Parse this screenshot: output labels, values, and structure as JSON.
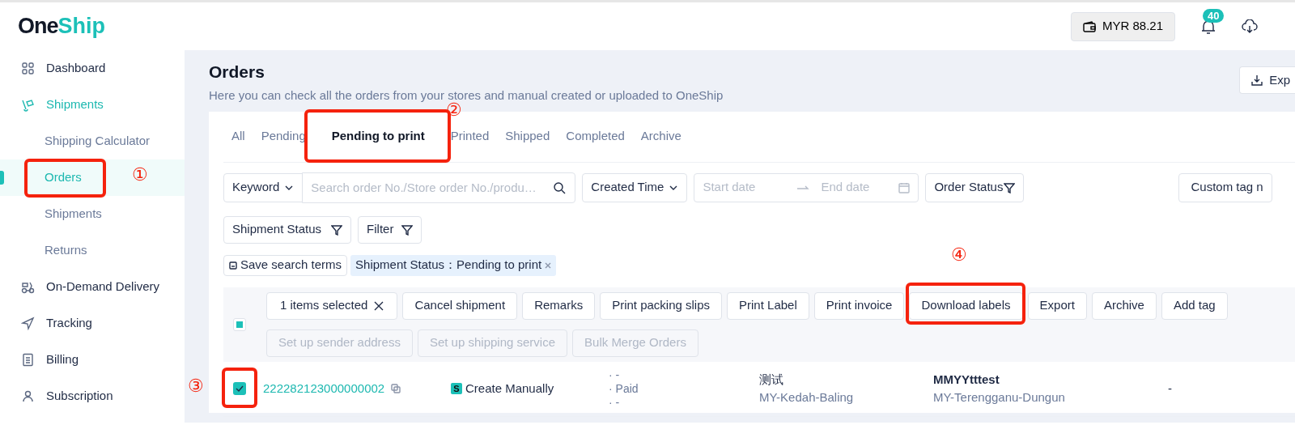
{
  "logo": {
    "part_1": "One",
    "part_2": "Ship"
  },
  "header": {
    "balance": "MYR 88.21",
    "notification_count": "40"
  },
  "sidebar": {
    "items": [
      {
        "label": "Dashboard"
      },
      {
        "label": "Shipments",
        "children": [
          {
            "label": "Shipping Calculator",
            "selected": false
          },
          {
            "label": "Orders",
            "selected": true,
            "callout": "①"
          },
          {
            "label": "Shipments",
            "selected": false
          },
          {
            "label": "Returns",
            "selected": false
          }
        ]
      },
      {
        "label": "On-Demand Delivery"
      },
      {
        "label": "Tracking"
      },
      {
        "label": "Billing"
      },
      {
        "label": "Subscription"
      }
    ]
  },
  "page": {
    "title": "Orders",
    "subtitle": "Here you can check all the orders from your stores and manual created or uploaded to OneShip",
    "export_button": "Exp"
  },
  "tabs": [
    {
      "label": "All",
      "selected": false
    },
    {
      "label": "Pending",
      "selected": false
    },
    {
      "label": "Pending to print",
      "selected": true,
      "callout": "②"
    },
    {
      "label": "Printed",
      "selected": false
    },
    {
      "label": "Shipped",
      "selected": false
    },
    {
      "label": "Completed",
      "selected": false
    },
    {
      "label": "Archive",
      "selected": false
    }
  ],
  "filters": {
    "keyword": "Keyword",
    "search_placeholder": "Search order No./Store order No./produ…",
    "created_time": "Created Time",
    "start_placeholder": "Start date",
    "end_placeholder": "End date",
    "order_status": "Order Status",
    "custom_tag": "Custom tag n",
    "shipment_status": "Shipment Status",
    "filter": "Filter"
  },
  "saved": {
    "save_button": "Save search terms",
    "chips": [
      "Shipment Status：Pending to print"
    ]
  },
  "bulk": {
    "select_all_indeterminate": true,
    "selected_count": "1 items selected",
    "actions": [
      {
        "label": "Cancel shipment",
        "disabled": false
      },
      {
        "label": "Remarks",
        "disabled": false
      },
      {
        "label": "Print packing slips",
        "disabled": false
      },
      {
        "label": "Print Label",
        "disabled": false
      },
      {
        "label": "Print invoice",
        "disabled": false
      },
      {
        "label": "Download labels",
        "disabled": false,
        "callout": "④"
      },
      {
        "label": "Export",
        "disabled": false
      },
      {
        "label": "Archive",
        "disabled": false
      },
      {
        "label": "Add tag",
        "disabled": false
      },
      {
        "label": "Set up sender address",
        "disabled": true
      },
      {
        "label": "Set up shipping service",
        "disabled": true
      },
      {
        "label": "Bulk Merge Orders",
        "disabled": true
      }
    ]
  },
  "rows": [
    {
      "checked": true,
      "callout": "③",
      "order_no": "222282123000000002",
      "source_badge": "S",
      "source": "Create Manually",
      "statuses": [
        "· -",
        "· Paid",
        "· -"
      ],
      "sender_name": "测试",
      "sender_region": "MY-Kedah-Baling",
      "recipient_name": "MMYYtttest",
      "recipient_region": "MY-Terengganu-Dungun",
      "column_7": "-"
    }
  ]
}
